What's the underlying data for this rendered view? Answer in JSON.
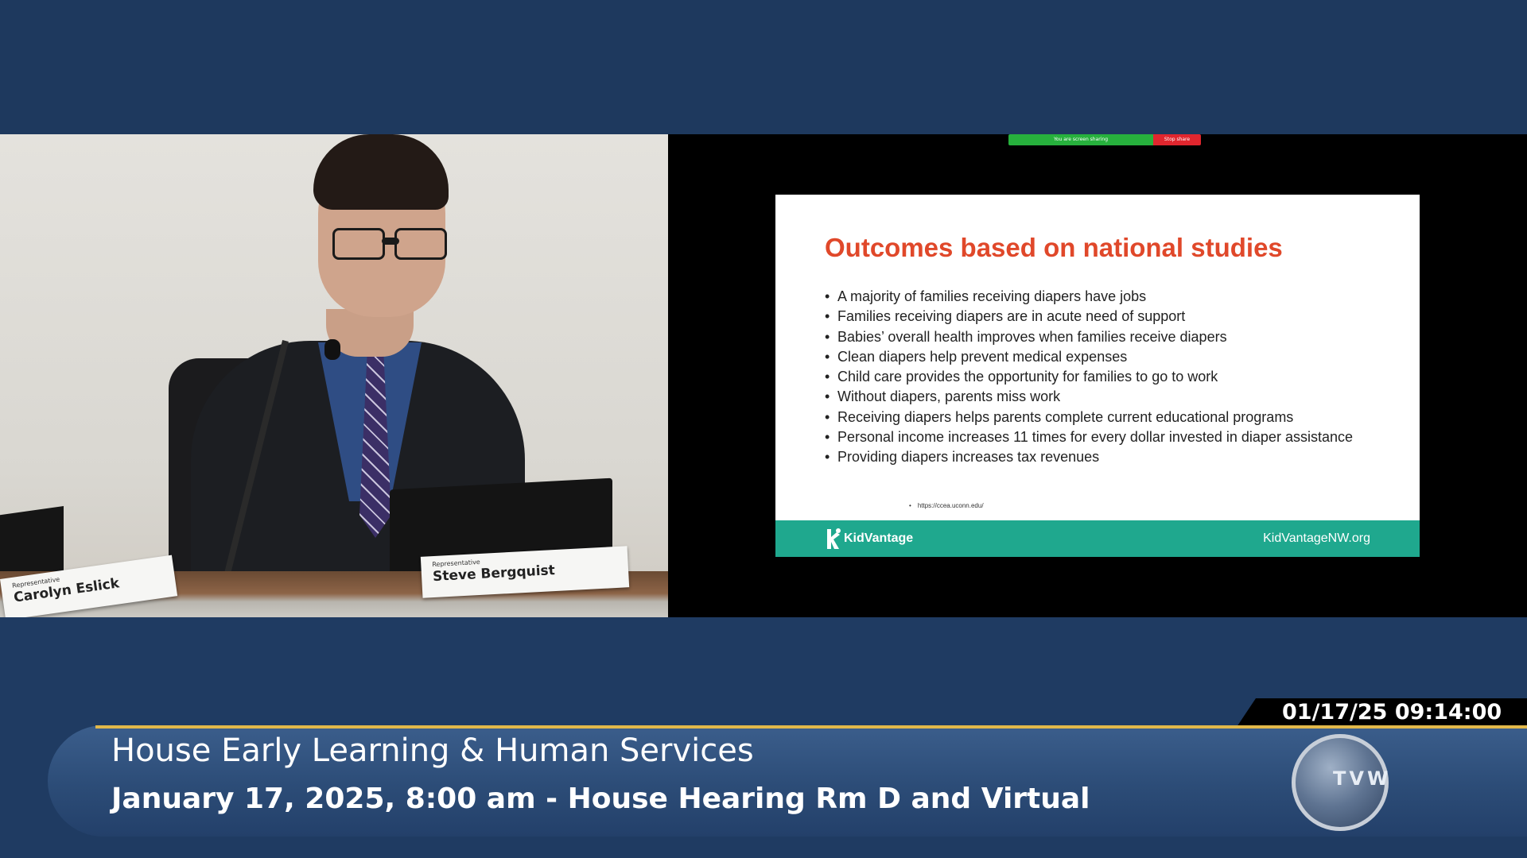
{
  "camera": {
    "nameplate_left": {
      "title": "Representative",
      "name": "Carolyn Eslick"
    },
    "nameplate_right": {
      "title": "Representative",
      "name": "Steve Bergquist"
    }
  },
  "zoom": {
    "sharing_label": "You are screen sharing",
    "stop_label": "Stop share"
  },
  "slide": {
    "title": "Outcomes based on national studies",
    "bullets": [
      "A majority of families receiving diapers have jobs",
      "Families receiving diapers are in acute need of support",
      "Babies’ overall health improves when families receive diapers",
      "Clean diapers help prevent medical expenses",
      "Child care provides the opportunity for families to go to work",
      "Without diapers, parents miss work",
      "Receiving diapers helps parents complete current educational programs",
      "Personal income increases 11 times for every dollar invested in diaper assistance",
      "Providing diapers increases tax revenues"
    ],
    "source": "https://ccea.uconn.edu/",
    "footer_logo": "KidVantage",
    "footer_url": "KidVantageNW.org",
    "accent_color": "#e0482a",
    "footer_color": "#1fa88e"
  },
  "broadcast": {
    "timestamp": "01/17/25 09:14:00 AM",
    "title": "House Early Learning & Human Services",
    "subtitle": "January 17, 2025, 8:00 am - House Hearing Rm D and Virtual",
    "logo_text": "TVW",
    "accent_color": "#e1b84a"
  }
}
